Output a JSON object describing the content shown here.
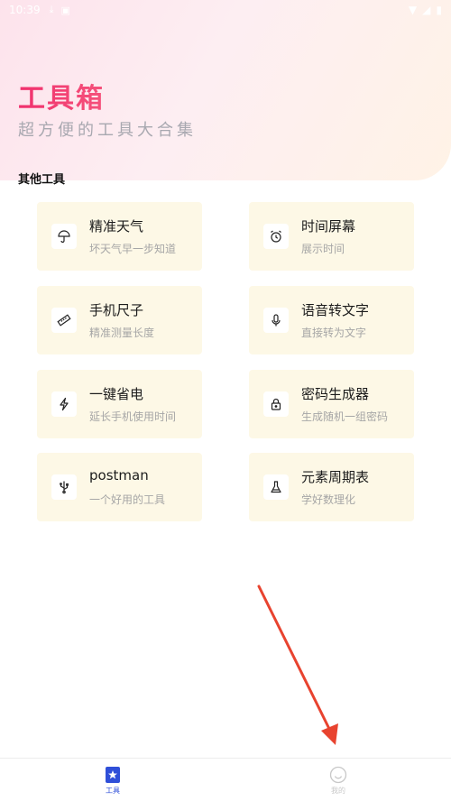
{
  "status_bar": {
    "time": "10:39"
  },
  "header": {
    "title": "工具箱",
    "subtitle": "超方便的工具大合集"
  },
  "section": {
    "title": "其他工具"
  },
  "tools": [
    {
      "name": "精准天气",
      "desc": "坏天气早一步知道",
      "icon": "umbrella-icon"
    },
    {
      "name": "时间屏幕",
      "desc": "展示时间",
      "icon": "alarm-clock-icon"
    },
    {
      "name": "手机尺子",
      "desc": "精准测量长度",
      "icon": "ruler-icon"
    },
    {
      "name": "语音转文字",
      "desc": "直接转为文字",
      "icon": "microphone-icon"
    },
    {
      "name": "一键省电",
      "desc": "延长手机使用时间",
      "icon": "lightning-icon"
    },
    {
      "name": "密码生成器",
      "desc": "生成随机一组密码",
      "icon": "lock-icon"
    },
    {
      "name": "postman",
      "desc": "一个好用的工具",
      "icon": "usb-icon"
    },
    {
      "name": "元素周期表",
      "desc": "学好数理化",
      "icon": "flask-icon"
    }
  ],
  "tabbar": {
    "tabs": [
      {
        "label": "工具",
        "icon": "star-bookmark-icon",
        "active": true
      },
      {
        "label": "我的",
        "icon": "smiley-icon",
        "active": false
      }
    ]
  },
  "colors": {
    "accent": "#f0306d",
    "active_tab": "#2f4fd8",
    "inactive_tab": "#c8c8c8",
    "card_bg": "#fdf8e6",
    "arrow": "#e8432f"
  }
}
